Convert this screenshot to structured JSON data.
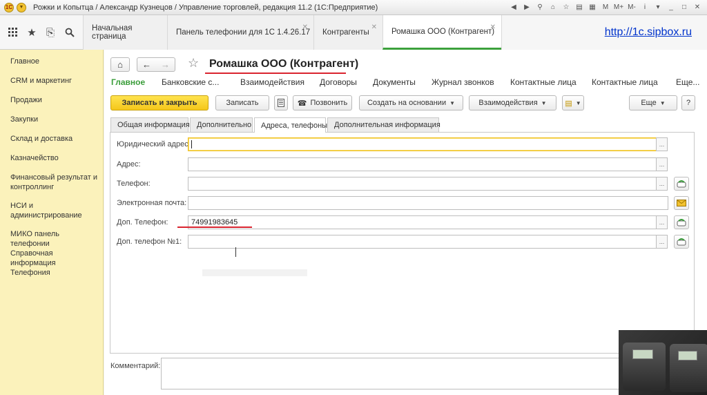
{
  "window": {
    "title": "Рожки и Копытца / Александр Кузнецов / Управление торговлей, редакция 11.2  (1С:Предприятие)"
  },
  "tabs": [
    {
      "label": "Начальная страница"
    },
    {
      "label": "Панель телефонии для 1С 1.4.26.17"
    },
    {
      "label": "Контрагенты"
    },
    {
      "label": "Ромашка ООО (Контрагент)"
    }
  ],
  "site_link": "http://1c.sipbox.ru",
  "sidebar": {
    "items": [
      {
        "label": "Главное"
      },
      {
        "label": "CRM и маркетинг"
      },
      {
        "label": "Продажи"
      },
      {
        "label": "Закупки"
      },
      {
        "label": "Склад и доставка"
      },
      {
        "label": "Казначейство"
      },
      {
        "label": "Финансовый результат и контроллинг"
      },
      {
        "label": "НСИ и администрирование"
      },
      {
        "label": "МИКО панель телефонии"
      },
      {
        "label": "Справочная информация"
      },
      {
        "label": "Телефония"
      }
    ]
  },
  "form": {
    "title": "Ромашка ООО (Контрагент)",
    "panel": [
      {
        "label": "Главное"
      },
      {
        "label": "Банковские с..."
      },
      {
        "label": "Взаимодействия"
      },
      {
        "label": "Договоры"
      },
      {
        "label": "Документы"
      },
      {
        "label": "Журнал звонков"
      },
      {
        "label": "Контактные лица"
      },
      {
        "label": "Контактные лица"
      },
      {
        "label": "Еще..."
      }
    ],
    "buttons": {
      "save_close": "Записать и закрыть",
      "save": "Записать",
      "call": "Позвонить",
      "create_based": "Создать на основании",
      "interactions": "Взаимодействия",
      "more": "Еще",
      "help": "?"
    },
    "tabs": [
      {
        "label": "Общая информация"
      },
      {
        "label": "Дополнительно"
      },
      {
        "label": "Адреса, телефоны"
      },
      {
        "label": "Дополнительная информация"
      }
    ],
    "fields": {
      "legal_address": {
        "label": "Юридический адрес:",
        "value": ""
      },
      "address": {
        "label": "Адрес:",
        "value": ""
      },
      "phone": {
        "label": "Телефон:",
        "value": ""
      },
      "email": {
        "label": "Электронная почта:",
        "value": ""
      },
      "extra_phone": {
        "label": "Доп. Телефон:",
        "value": "74991983645"
      },
      "extra_phone_1": {
        "label": "Доп. телефон №1:",
        "value": ""
      }
    },
    "comment_label": "Комментарий:",
    "ellipsis": "..."
  }
}
